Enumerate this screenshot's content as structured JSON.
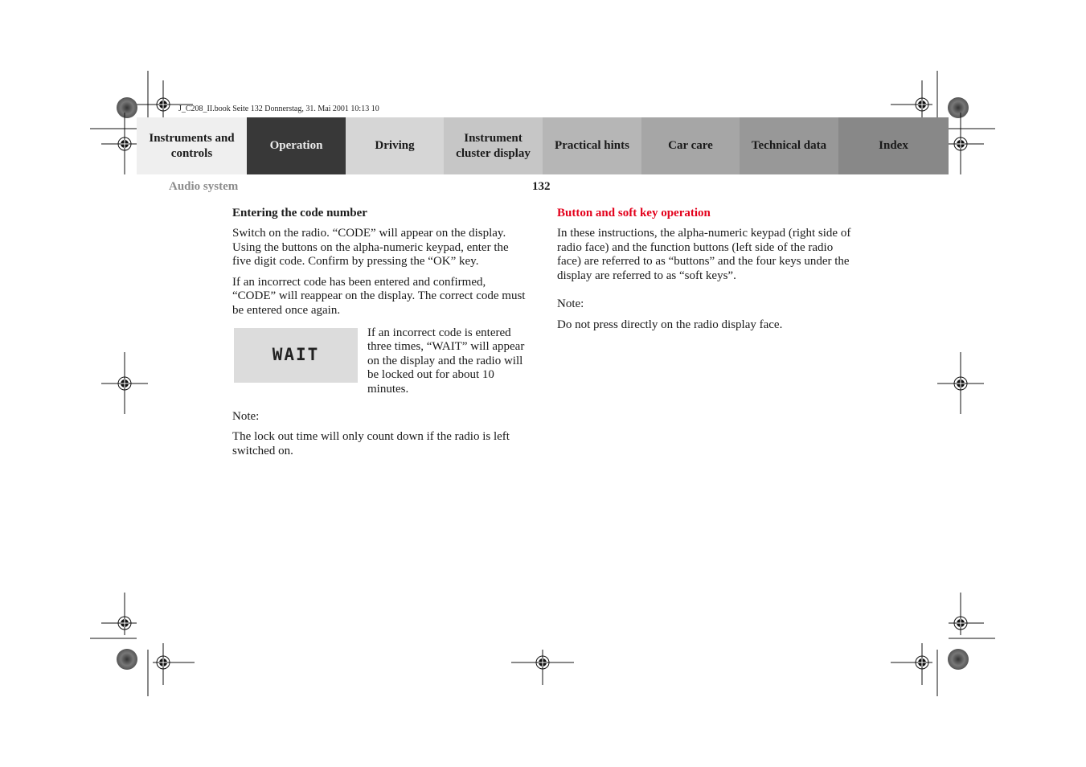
{
  "print_info": "J_C208_II.book  Seite 132  Donnerstag, 31. Mai 2001  10:13 10",
  "nav": {
    "tabs": [
      {
        "label": "Instruments and controls",
        "active": false
      },
      {
        "label": "Operation",
        "active": true
      },
      {
        "label": "Driving",
        "active": false
      },
      {
        "label": "Instrument cluster display",
        "active": false
      },
      {
        "label": "Practical hints",
        "active": false
      },
      {
        "label": "Car care",
        "active": false
      },
      {
        "label": "Technical data",
        "active": false
      },
      {
        "label": "Index",
        "active": false
      }
    ]
  },
  "header": {
    "section_title": "Audio system",
    "page_number": "132"
  },
  "left_column": {
    "heading": "Entering the code number",
    "para1": "Switch on the radio. “CODE” will appear on the display. Using the buttons on the alpha-numeric keypad, enter the five digit code. Confirm by pressing the “OK” key.",
    "para2": "If an incorrect code has been entered and confirmed, “CODE” will reappear on the display. The correct code must be entered once again.",
    "display_text": "WAIT",
    "display_caption": "If an incorrect code is entered three times, “WAIT” will appear on the display and the radio will be locked out for about 10 minutes.",
    "note_label": "Note:",
    "note_text": "The lock out time will only count down if the radio is left switched on."
  },
  "right_column": {
    "heading": "Button and soft key operation",
    "heading_color": "#e3001b",
    "para1": "In these instructions, the alpha-numeric keypad (right side of radio face) and the function buttons (left side of the radio face) are referred to as “buttons” and the four keys under the display are referred to as “soft keys”.",
    "note_label": "Note:",
    "note_text": "Do not press directly on the radio display face."
  }
}
